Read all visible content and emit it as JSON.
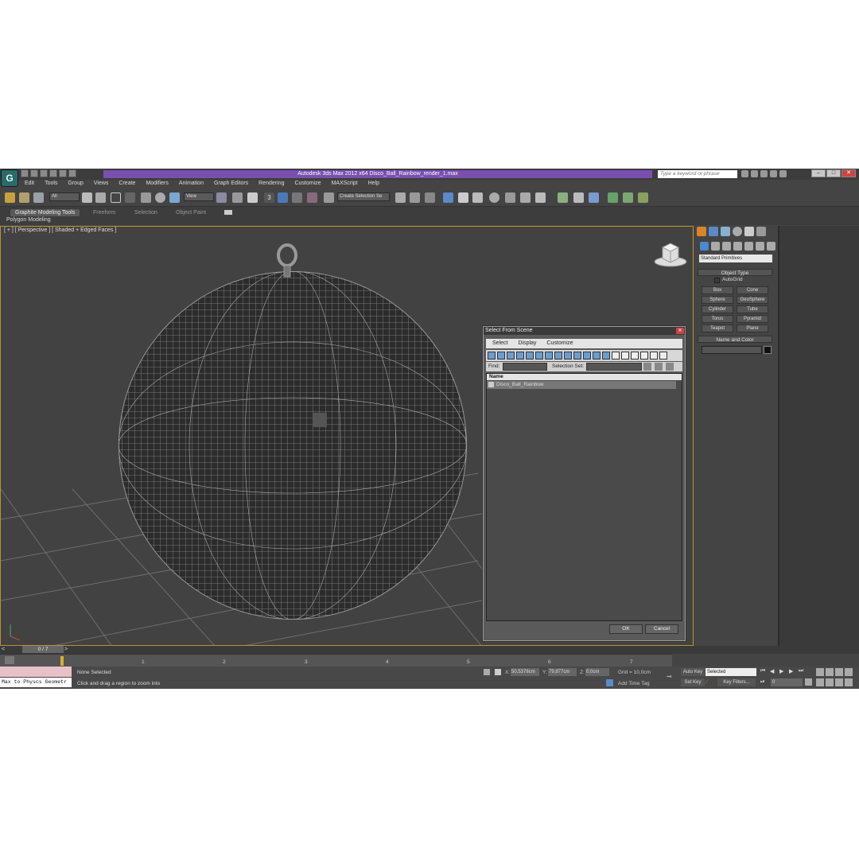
{
  "window": {
    "title": "Autodesk 3ds Max  2012 x64      Disco_Ball_Rainbow_render_1.max",
    "search_placeholder": "Type a keyword or phrase",
    "app_letter": "G",
    "accent": "#7a4fb0"
  },
  "menu": [
    "Edit",
    "Tools",
    "Group",
    "Views",
    "Create",
    "Modifiers",
    "Animation",
    "Graph Editors",
    "Rendering",
    "Customize",
    "MAXScript",
    "Help"
  ],
  "toolbar": {
    "filter_value": "All",
    "refcoord_value": "View",
    "selection_set_value": "Create Selection Se",
    "snap_label": "3"
  },
  "ribbon": {
    "tabs": [
      "Graphite Modeling Tools",
      "Freeform",
      "Selection",
      "Object Paint"
    ],
    "sub_label": "Polygon Modeling"
  },
  "viewport": {
    "label": "[ + ] [ Perspective ] [ Shaded + Edged Faces ]"
  },
  "command_panel": {
    "category": "Standard Primitives",
    "object_type_header": "Object Type",
    "autogrid": "AutoGrid",
    "primitives": [
      "Box",
      "Cone",
      "Sphere",
      "GeoSphere",
      "Cylinder",
      "Tube",
      "Torus",
      "Pyramid",
      "Teapot",
      "Plane"
    ],
    "name_color_header": "Name and Color"
  },
  "dialog": {
    "title": "Select From Scene",
    "menu": [
      "Select",
      "Display",
      "Customize"
    ],
    "find_label": "Find:",
    "selection_set_label": "Selection Set:",
    "column_name": "Name",
    "items": [
      "Disco_Ball_Rainbow"
    ],
    "ok": "OK",
    "cancel": "Cancel"
  },
  "timeline": {
    "frame_counter": "0 / 7",
    "ticks": [
      "1",
      "2",
      "3",
      "4",
      "5",
      "6",
      "7"
    ]
  },
  "status": {
    "maxscript_line": "Max to Physcs Geometr",
    "selection": "None Selected",
    "prompt": "Click and drag a region to zoom into",
    "x_label": "X:",
    "x_value": "50,5378cm",
    "y_label": "Y:",
    "y_value": "79,877cm",
    "z_label": "Z:",
    "z_value": "0,0cm",
    "grid": "Grid = 10,0cm",
    "add_time_tag": "Add Time Tag",
    "auto_key": "Auto Key",
    "set_key": "Set Key",
    "key_mode_value": "Selected",
    "key_filters": "Key Filters...",
    "frame_value": "0"
  }
}
